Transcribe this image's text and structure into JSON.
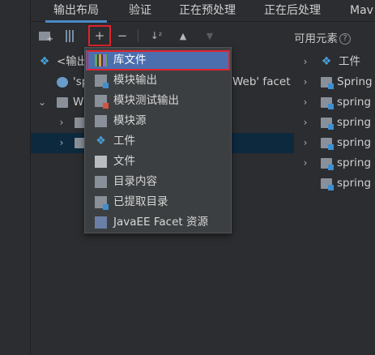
{
  "tabs": [
    {
      "label": "输出布局",
      "active": true
    },
    {
      "label": "验证",
      "active": false
    },
    {
      "label": "正在预处理",
      "active": false
    },
    {
      "label": "正在后处理",
      "active": false
    },
    {
      "label": "Mav",
      "active": false
    }
  ],
  "toolbar": {
    "icons": [
      "new-folder-icon",
      "library-icon",
      "add-icon",
      "remove-icon",
      "sort-icon",
      "move-up-icon",
      "move-down-icon"
    ],
    "add_symbol": "+",
    "remove_symbol": "−",
    "sort_symbol": "↓ᶻ",
    "up_symbol": "▲",
    "down_symbol": "▼"
  },
  "available": {
    "label": "可用元素",
    "help": "?",
    "items": [
      {
        "label": "工件",
        "icon": "artifact-icon"
      },
      {
        "label": "Spring",
        "icon": "module-icon"
      },
      {
        "label": "spring",
        "icon": "module-icon"
      },
      {
        "label": "spring",
        "icon": "module-icon"
      },
      {
        "label": "spring",
        "icon": "module-icon"
      },
      {
        "label": "spring",
        "icon": "module-icon"
      },
      {
        "label": "spring",
        "icon": "module-icon"
      }
    ]
  },
  "tree": {
    "root_label": "<输出",
    "web_label_left": "'sp",
    "web_label_right": "Web' facet",
    "war_label": "W",
    "expand": "›",
    "collapse": "⌄"
  },
  "menu": {
    "items": [
      {
        "label": "库文件",
        "icon": "library-icon",
        "selected": true
      },
      {
        "label": "模块输出",
        "icon": "module-output-icon",
        "selected": false
      },
      {
        "label": "模块测试输出",
        "icon": "module-test-output-icon",
        "selected": false
      },
      {
        "label": "模块源",
        "icon": "module-source-icon",
        "selected": false
      },
      {
        "label": "工件",
        "icon": "artifact-icon",
        "selected": false
      },
      {
        "label": "文件",
        "icon": "file-icon",
        "selected": false
      },
      {
        "label": "目录内容",
        "icon": "directory-content-icon",
        "selected": false
      },
      {
        "label": "已提取目录",
        "icon": "extracted-directory-icon",
        "selected": false
      },
      {
        "label": "JavaEE Facet 资源",
        "icon": "javaee-facet-icon",
        "selected": false
      }
    ]
  },
  "colors": {
    "background": "#2b2d30",
    "menu_background": "#3c3f41",
    "menu_selected": "#4b6eaf",
    "highlight_border": "#e0232d",
    "tree_selected": "#0d293e",
    "accent_blue": "#4a9fd8"
  }
}
